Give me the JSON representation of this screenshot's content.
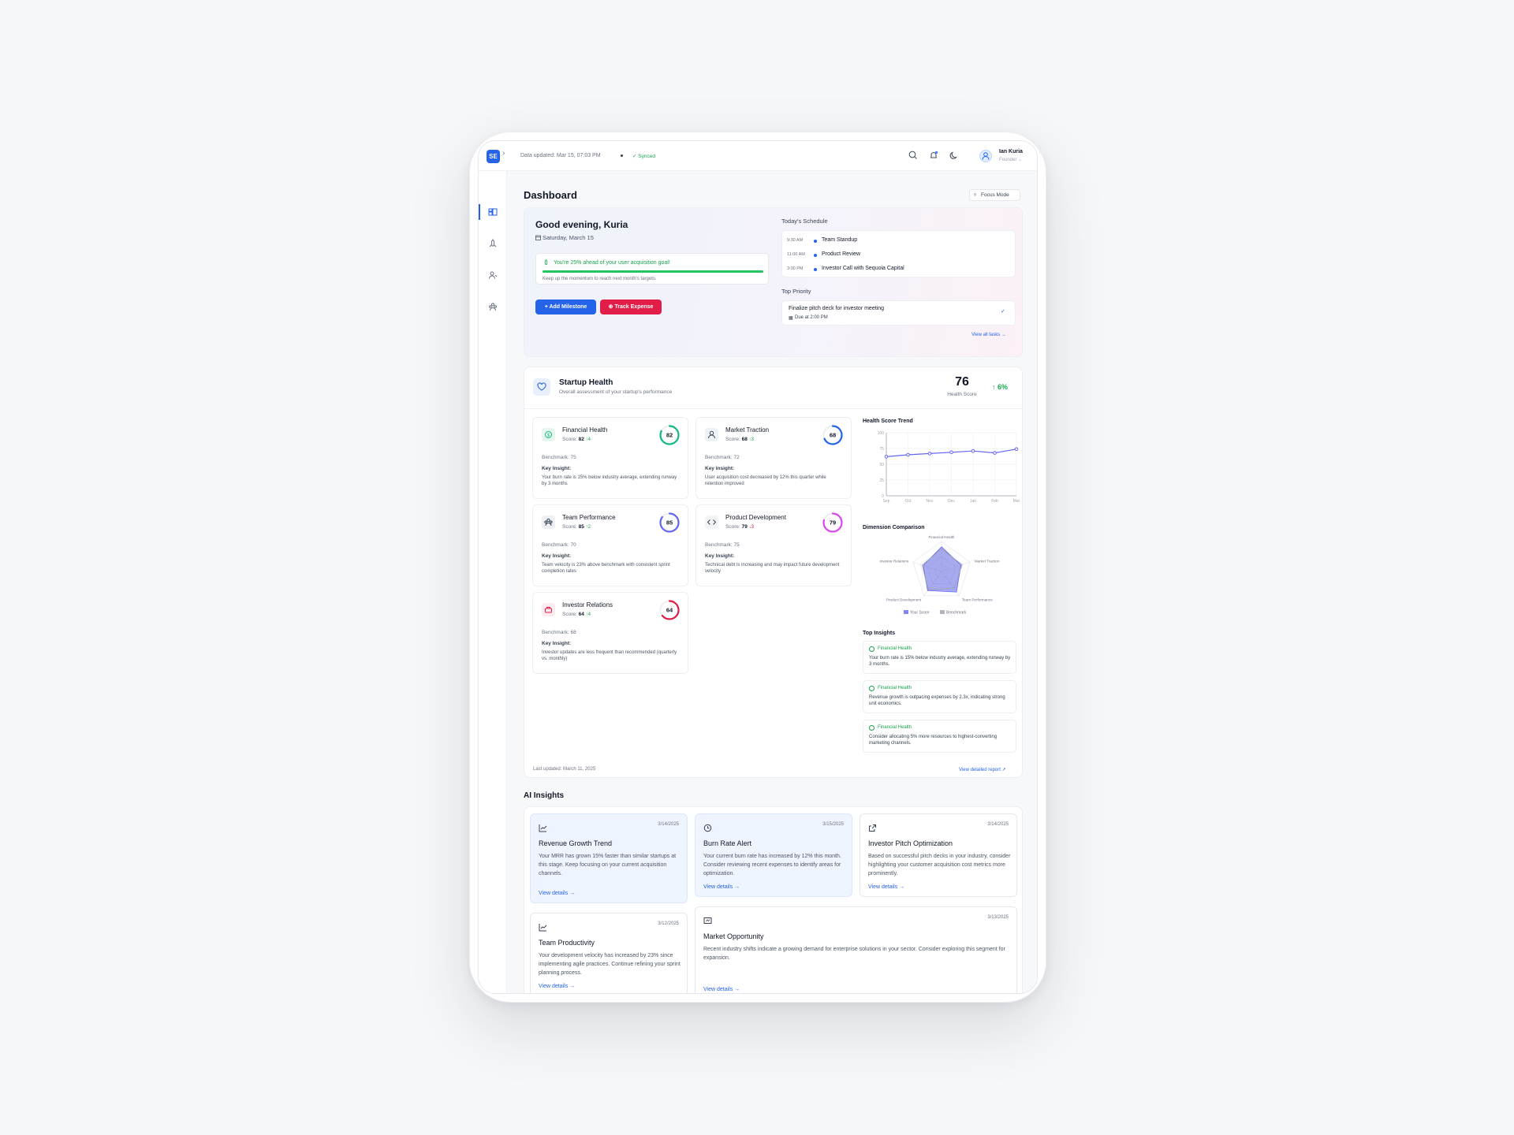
{
  "topbar": {
    "logo": "SE",
    "data_updated": "Data updated: Mar 15, 07:03 PM",
    "synced": "Synced",
    "user_name": "Ian Kuria",
    "user_role": "Founder",
    "icons": [
      "search-icon",
      "bell-icon",
      "moon-icon",
      "user-icon"
    ]
  },
  "sidebar": {
    "items": [
      {
        "icon": "dashboard-icon",
        "active": true
      },
      {
        "icon": "rocket-icon",
        "active": false
      },
      {
        "icon": "users-icon",
        "active": false
      },
      {
        "icon": "team-icon",
        "active": false
      }
    ]
  },
  "page": {
    "title": "Dashboard",
    "focus_mode": "Focus Mode"
  },
  "welcome": {
    "greeting": "Good evening, Kuria",
    "date": "Saturday, March 15",
    "goal_title": "You're 25% ahead of your user acquisition goal!",
    "goal_sub": "Keep up the momentum to reach next month's targets.",
    "add_milestone": "+ Add Milestone",
    "track_expense": "Track Expense",
    "schedule_title": "Today's Schedule",
    "schedule": [
      {
        "time": "9:30 AM",
        "label": "Team Standup"
      },
      {
        "time": "11:00 AM",
        "label": "Product Review"
      },
      {
        "time": "3:00 PM",
        "label": "Investor Call with Sequoia Capital"
      }
    ],
    "priority_title": "Top Priority",
    "priority_task": "Finalize pitch deck for investor meeting",
    "priority_due": "Due at 2:00 PM",
    "view_all": "View all tasks →"
  },
  "health": {
    "title": "Startup Health",
    "subtitle": "Overall assessment of your startup's performance",
    "score": "76",
    "score_label": "Health Score",
    "change": "6%",
    "last_updated": "Last updated: March 11, 2025",
    "view_report": "View detailed report",
    "cards": [
      {
        "title": "Financial Health",
        "score_label": "Score:",
        "score": "82",
        "delta": "↑4",
        "ring": 82,
        "color": "#10b981",
        "bg": "#e7f7ef",
        "benchmark": "Benchmark: 75",
        "insight_label": "Key Insight:",
        "insight": "Your burn rate is 15% below industry average, extending runway by 3 months"
      },
      {
        "title": "Market Traction",
        "score_label": "Score:",
        "score": "68",
        "delta": "↑3",
        "ring": 68,
        "color": "#2563eb",
        "bg": "#eef2f7",
        "benchmark": "Benchmark: 72",
        "insight_label": "Key Insight:",
        "insight": "User acquisition cost decreased by 12% this quarter while retention improved"
      },
      {
        "title": "Team Performance",
        "score_label": "Score:",
        "score": "85",
        "delta": "↑2",
        "ring": 85,
        "color": "#6366f1",
        "bg": "#eef0f4",
        "benchmark": "Benchmark: 70",
        "insight_label": "Key Insight:",
        "insight": "Team velocity is 23% above benchmark with consistent sprint completion rates"
      },
      {
        "title": "Product Development",
        "score_label": "Score:",
        "score": "79",
        "delta": "↓3",
        "ring": 79,
        "color": "#d946ef",
        "bg": "#f3f4f6",
        "benchmark": "Benchmark: 75",
        "insight_label": "Key Insight:",
        "insight": "Technical debt is increasing and may impact future development velocity"
      },
      {
        "title": "Investor Relations",
        "score_label": "Score:",
        "score": "64",
        "delta": "↑4",
        "ring": 64,
        "color": "#e11d48",
        "bg": "#fdecef",
        "benchmark": "Benchmark: 68",
        "insight_label": "Key Insight:",
        "insight": "Investor updates are less frequent than recommended (quarterly vs. monthly)"
      }
    ],
    "trend_title": "Health Score Trend",
    "radar_title": "Dimension Comparison",
    "insights_title": "Top Insights",
    "top_insights": [
      {
        "tag": "Financial Health",
        "text": "Your burn rate is 15% below industry average, extending runway by 3 months."
      },
      {
        "tag": "Financial Health",
        "text": "Revenue growth is outpacing expenses by 2.3x, indicating strong unit economics."
      },
      {
        "tag": "Financial Health",
        "text": "Consider allocating 5% more resources to highest-converting marketing channels."
      }
    ]
  },
  "chart_data": [
    {
      "type": "line",
      "title": "Health Score Trend",
      "x": [
        "Sep",
        "Oct",
        "Nov",
        "Dec",
        "Jan",
        "Feb",
        "Mar"
      ],
      "series": [
        {
          "values": [
            62,
            65,
            67,
            69,
            71,
            68,
            74
          ]
        }
      ],
      "ylim": [
        0,
        100
      ],
      "yticks": [
        0,
        25,
        50,
        75,
        100
      ],
      "grid": true
    },
    {
      "type": "radar",
      "title": "Dimension Comparison",
      "axes": [
        "Financial Health",
        "Market Traction",
        "Team Performance",
        "Product Development",
        "Investor Relations"
      ],
      "series": [
        {
          "name": "Your Score",
          "values": [
            82,
            68,
            85,
            79,
            64
          ],
          "color": "#6366f1"
        },
        {
          "name": "Benchmark",
          "values": [
            75,
            72,
            70,
            75,
            68
          ],
          "color": "#9ca3af"
        }
      ],
      "legend": "bottom"
    }
  ],
  "ai": {
    "title": "AI Insights",
    "cards": [
      {
        "icon": "line-chart-icon",
        "date": "3/14/2025",
        "title": "Revenue Growth Trend",
        "text": "Your MRR has grown 15% faster than similar startups at this stage. Keep focusing on your current acquisition channels.",
        "link": "View details →"
      },
      {
        "icon": "clock-icon",
        "date": "3/15/2025",
        "title": "Burn Rate Alert",
        "text": "Your current burn rate has increased by 12% this month. Consider reviewing recent expenses to identify areas for optimization.",
        "link": "View details →"
      },
      {
        "icon": "share-icon",
        "date": "3/14/2025",
        "title": "Investor Pitch Optimization",
        "text": "Based on successful pitch decks in your industry, consider highlighting your customer acquisition cost metrics more prominently.",
        "link": "View details →"
      },
      {
        "icon": "line-chart-icon",
        "date": "3/12/2025",
        "title": "Team Productivity",
        "text": "Your development velocity has increased by 23% since implementing agile practices. Continue refining your sprint planning process.",
        "link": "View details →"
      },
      {
        "icon": "presentation-icon",
        "date": "3/13/2025",
        "title": "Market Opportunity",
        "text": "Recent industry shifts indicate a growing demand for enterprise solutions in your sector. Consider exploring this segment for expansion.",
        "link": "View details →"
      }
    ]
  }
}
